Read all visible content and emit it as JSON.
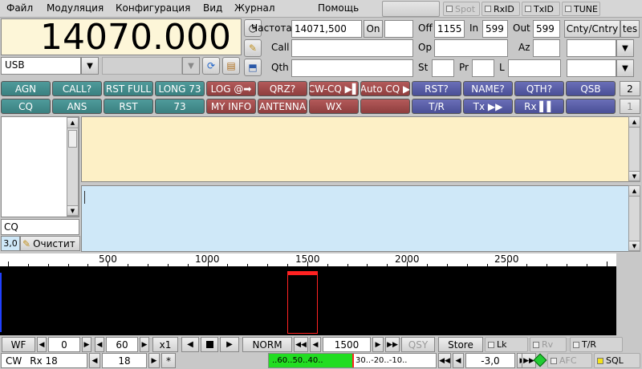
{
  "menu": [
    {
      "id": "file",
      "label": "Файл"
    },
    {
      "id": "modulation",
      "label": "Модуляция"
    },
    {
      "id": "config",
      "label": "Конфигурация"
    },
    {
      "id": "view",
      "label": "Вид"
    },
    {
      "id": "log",
      "label": "Журнал"
    },
    {
      "id": "help",
      "label": "Помощь"
    }
  ],
  "top_toggles": {
    "spot": "Spot",
    "rxid": "RxID",
    "txid": "TxID",
    "tune": "TUNE"
  },
  "frequency_display": "14070.000",
  "mode": "USB",
  "log_fields": {
    "freq_label": "Частота",
    "freq_value": "14071,500",
    "on_label": "On",
    "off_label": "Off",
    "off_value": "1155",
    "in_label": "In",
    "in_value": "599",
    "out_label": "Out",
    "out_value": "599",
    "cnty_label": "Cnty/Cntry",
    "tes_label": "tes",
    "call_label": "Call",
    "op_label": "Op",
    "az_label": "Az",
    "qth_label": "Qth",
    "st_label": "St",
    "pr_label": "Pr",
    "l_label": "L"
  },
  "macros_row1": [
    "AGN",
    "CALL?",
    "RST FULL",
    "LONG 73",
    "LOG @➡",
    "QRZ?",
    "CW-CQ ▶▌",
    "Auto CQ ▶",
    "RST?",
    "NAME?",
    "QTH?",
    "QSB"
  ],
  "macros_row2": [
    "CQ",
    "ANS",
    "RST",
    "73",
    "MY INFO",
    "ANTENNA",
    "WX",
    "",
    "T/R",
    "Tx ▶▶",
    "Rx ▌▌",
    ""
  ],
  "macro_set_1": "2",
  "macro_set_2": "1",
  "left_panel": {
    "search_value": "CQ",
    "clear_label": "Очистит",
    "num_label": "3,0"
  },
  "waterfall": {
    "scale_labels": [
      "500",
      "1000",
      "1500",
      "2000",
      "2500"
    ]
  },
  "bottom_row1": {
    "wf": "WF",
    "wf_offset": "0",
    "wf_range": "60",
    "zoom": "x1",
    "norm": "NORM",
    "carrier": "1500",
    "qsy": "QSY",
    "store": "Store",
    "lk": "Lk",
    "rv": "Rv",
    "tr": "T/R"
  },
  "bottom_row2": {
    "status_mode": "CW",
    "status_rx": "Rx 18",
    "squelch_value": "18",
    "asterisk": "*",
    "meter_left": "..60..50..40..",
    "meter_right": "30..-20..-10..",
    "afc_value": "-3,0",
    "afc": "AFC",
    "sql": "SQL"
  },
  "colors": {
    "rx_pane": "#fdf0c6",
    "tx_pane": "#cfe8f8",
    "freq_bg": "#fdf6d8",
    "macro_teal": "#3a8080",
    "macro_maroon": "#8e3e3e",
    "macro_navy": "#4a4f96",
    "meter_green": "#22dd22",
    "cursor_red": "#ff2222"
  }
}
